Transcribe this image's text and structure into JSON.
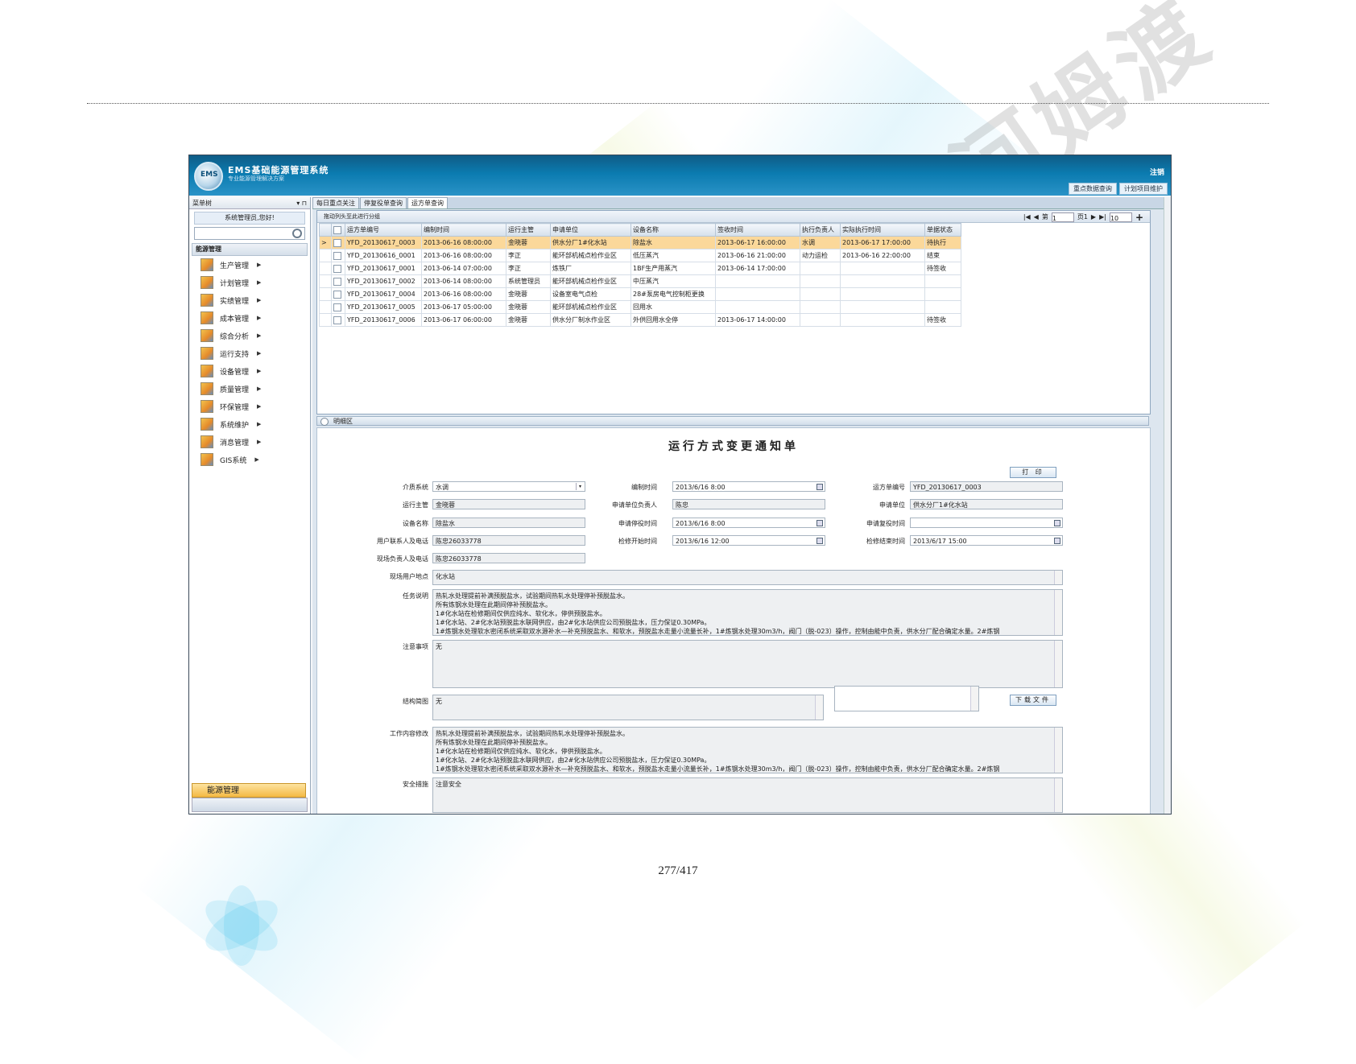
{
  "page": {
    "number": "277/417"
  },
  "app": {
    "logo_text": "EMS",
    "title": "EMS基础能源管理系统",
    "subtitle": "专业能源管理解决方案",
    "logout": "注销",
    "top_links": [
      "重点数据查询",
      "计划项目维护"
    ]
  },
  "sidebar": {
    "header": "菜单树",
    "header_controls": "▾ ⊓",
    "greeting": "系统管理员,您好!",
    "section": "能源管理",
    "items": [
      {
        "label": "生产管理"
      },
      {
        "label": "计划管理"
      },
      {
        "label": "实绩管理"
      },
      {
        "label": "成本管理"
      },
      {
        "label": "综合分析"
      },
      {
        "label": "运行支持"
      },
      {
        "label": "设备管理"
      },
      {
        "label": "质量管理"
      },
      {
        "label": "环保管理"
      },
      {
        "label": "系统维护"
      },
      {
        "label": "消息管理"
      },
      {
        "label": "GIS系统"
      }
    ],
    "bottom": "能源管理"
  },
  "tabs": [
    "每日重点关注",
    "停复役单查询",
    "运方单查询"
  ],
  "grid": {
    "hint": "拖动列头至此进行分组",
    "pager": {
      "page_label": "第",
      "page_value": "1",
      "of_label": "页1",
      "page_size": "10"
    },
    "columns": [
      "运方单编号",
      "编制时间",
      "运行主管",
      "申请单位",
      "设备名称",
      "签收时间",
      "执行负责人",
      "实际执行时间",
      "单据状态"
    ],
    "rows": [
      [
        "YFD_20130617_0003",
        "2013-06-16 08:00:00",
        "金晓蓉",
        "供水分厂1#化水站",
        "除盐水",
        "2013-06-17 16:00:00",
        "水调",
        "2013-06-17 17:00:00",
        "待执行"
      ],
      [
        "YFD_20130616_0001",
        "2013-06-16 08:00:00",
        "李正",
        "能环部机械点检作业区",
        "低压蒸汽",
        "2013-06-16 21:00:00",
        "动力运检",
        "2013-06-16 22:00:00",
        "结束"
      ],
      [
        "YFD_20130617_0001",
        "2013-06-14 07:00:00",
        "李正",
        "炼铁厂",
        "1BF生产用蒸汽",
        "2013-06-14 17:00:00",
        "",
        "",
        "待签收"
      ],
      [
        "YFD_20130617_0002",
        "2013-06-14 08:00:00",
        "系统管理员",
        "能环部机械点检作业区",
        "中压蒸汽",
        "",
        "",
        "",
        ""
      ],
      [
        "YFD_20130617_0004",
        "2013-06-16 08:00:00",
        "金晓蓉",
        "设备室电气点检",
        "28#泵房电气控制柜更换",
        "",
        "",
        "",
        ""
      ],
      [
        "YFD_20130617_0005",
        "2013-06-17 05:00:00",
        "金晓蓉",
        "能环部机械点检作业区",
        "回用水",
        "",
        "",
        "",
        ""
      ],
      [
        "YFD_20130617_0006",
        "2013-06-17 06:00:00",
        "金晓蓉",
        "供水分厂制水作业区",
        "外供回用水全停",
        "2013-06-17 14:00:00",
        "",
        "",
        "待签收"
      ]
    ]
  },
  "detail": {
    "bar_label": "明细区",
    "form_title": "运行方式变更通知单",
    "print_button": "打 印",
    "fields": {
      "medium_system": {
        "label": "介质系统",
        "value": "水调"
      },
      "compile_time": {
        "label": "编制时间",
        "value": "2013/6/16 8:00"
      },
      "order_no": {
        "label": "运方单编号",
        "value": "YFD_20130617_0003"
      },
      "supervisor": {
        "label": "运行主管",
        "value": "金晓蓉"
      },
      "apply_unit_head": {
        "label": "申请单位负责人",
        "value": "陈忠"
      },
      "apply_unit": {
        "label": "申请单位",
        "value": "供水分厂1#化水站"
      },
      "equipment": {
        "label": "设备名称",
        "value": "除盐水"
      },
      "apply_stop_time": {
        "label": "申请停役时间",
        "value": "2013/6/16 8:00"
      },
      "apply_resume_time": {
        "label": "申请复役时间",
        "value": ""
      },
      "user_contact": {
        "label": "用户联系人及电话",
        "value": "陈忠26033778"
      },
      "repair_start": {
        "label": "检修开始时间",
        "value": "2013/6/16 12:00"
      },
      "repair_end": {
        "label": "检修结束时间",
        "value": "2013/6/17 15:00"
      },
      "site_contact": {
        "label": "现场负责人及电话",
        "value": "陈忠26033778"
      },
      "site_location": {
        "label": "现场用户地点",
        "value": "化水站"
      },
      "task_desc": {
        "label": "任务说明",
        "lines": [
          "热轧水处理提前补满预脱盐水，试验期间热轧水处理停补预脱盐水。",
          "所有炼钢水处理在此期间停补预脱盐水。",
          "1#化水站在检修期间仅供应纯水、软化水，停供预脱盐水。",
          "1#化水站、2#化水站预脱盐水联网供应，由2#化水站供应公司预脱盐水，压力保证0.30MPa。",
          "1#炼钢水处理软水密闭系统采取双水源补水—补充预脱盐水、和软水，预脱盐水走量小流量长补，1#炼钢水处理30m3/h，阀门（脱-023）操作，控制由能中负责，供水分厂配合确定水量。2#炼钢"
        ]
      },
      "notes": {
        "label": "注意事项",
        "value": "无"
      },
      "structure_diagram": {
        "label": "结构简图",
        "value": "无"
      },
      "download_button": "下载文件",
      "work_change": {
        "label": "工作内容修改",
        "lines": [
          "热轧水处理提前补满预脱盐水，试验期间热轧水处理停补预脱盐水。",
          "所有炼钢水处理在此期间停补预脱盐水。",
          "1#化水站在检修期间仅供应纯水、软化水，停供预脱盐水。",
          "1#化水站、2#化水站预脱盐水联网供应，由2#化水站供应公司预脱盐水，压力保证0.30MPa。",
          "1#炼钢水处理软水密闭系统采取双水源补水—补充预脱盐水、和软水，预脱盐水走量小流量长补，1#炼钢水处理30m3/h，阀门（脱-023）操作，控制由能中负责，供水分厂配合确定水量。2#炼钢"
        ]
      },
      "safety": {
        "label": "安全措施",
        "value": "注意安全"
      }
    }
  },
  "watermark": {
    "text": "河姆渡"
  }
}
